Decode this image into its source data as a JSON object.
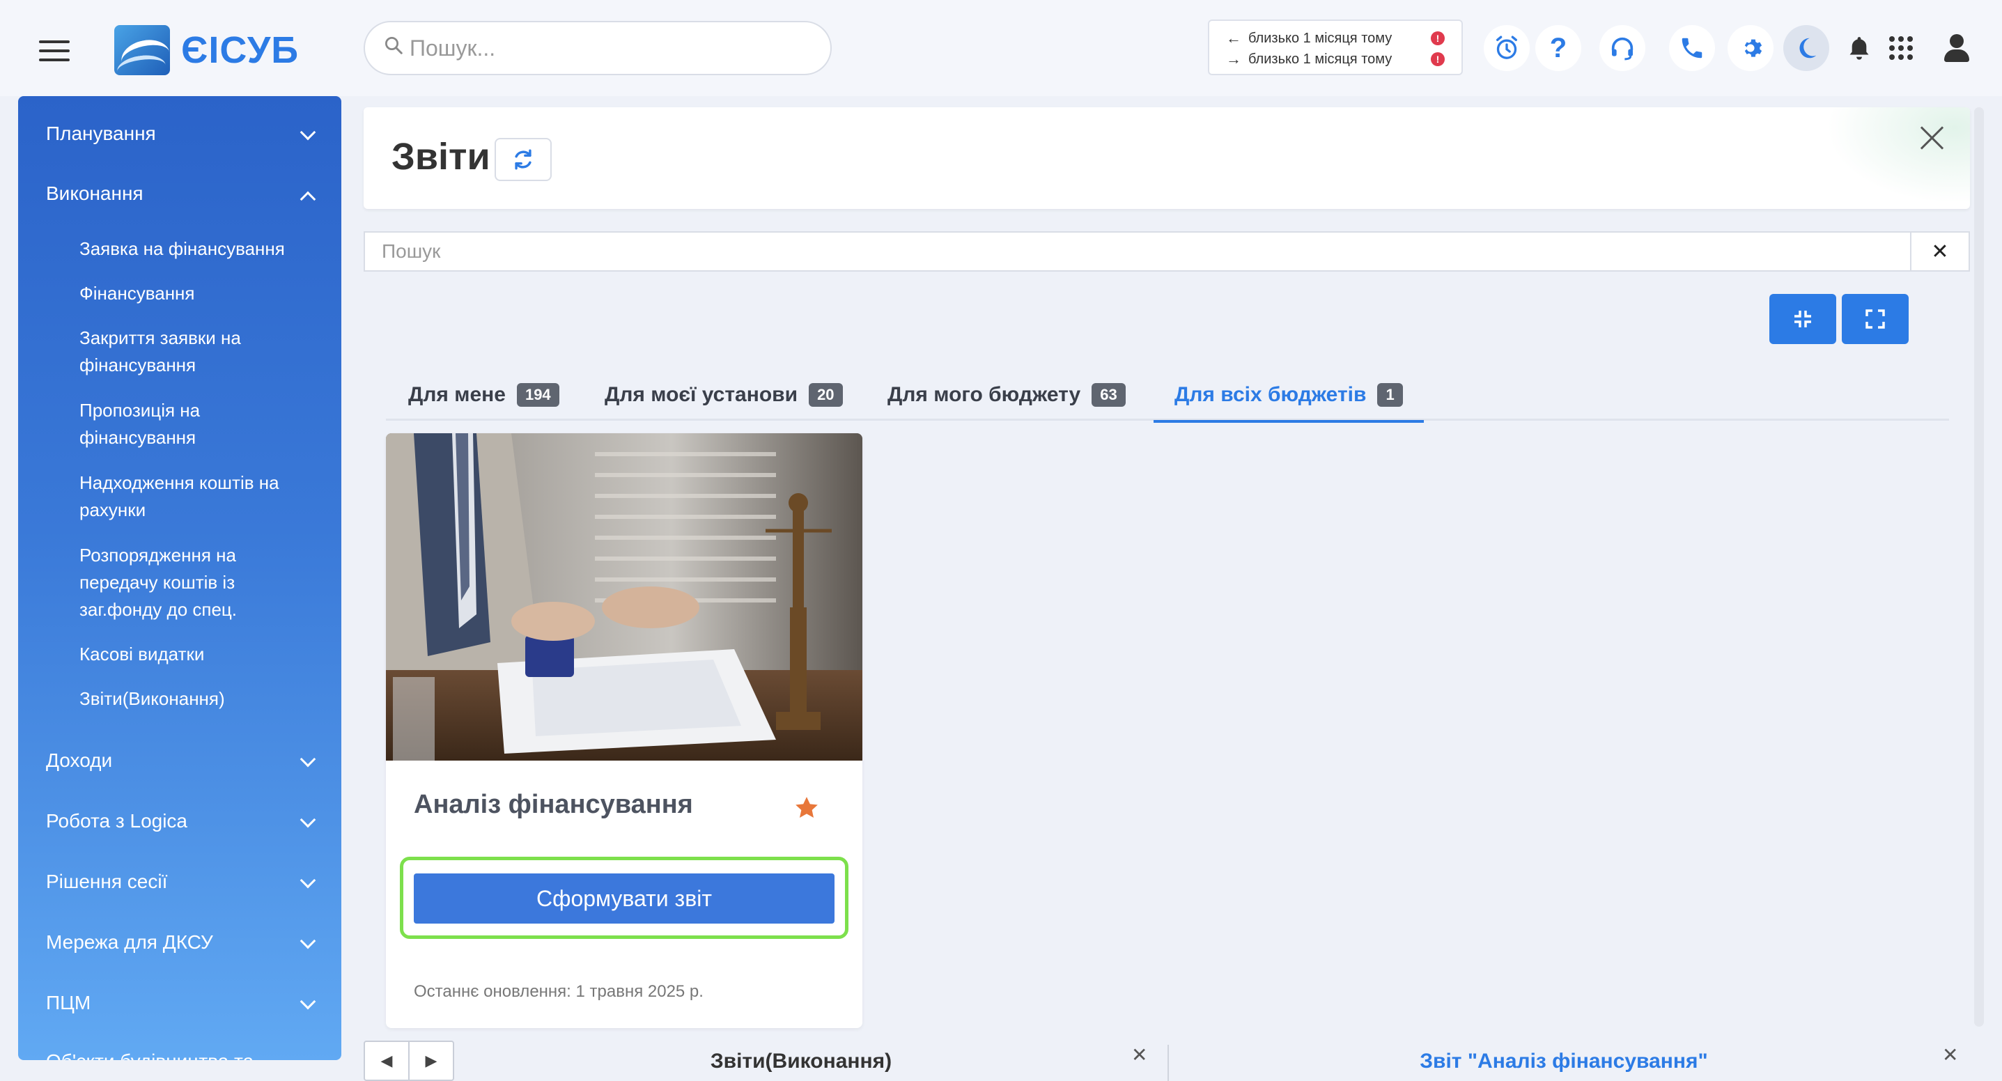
{
  "app": {
    "logo_text": "ЄІСУБ",
    "search_placeholder": "Пошук...",
    "sync": [
      {
        "direction": "←",
        "text": "близько 1 місяця тому",
        "alert": "!"
      },
      {
        "direction": "→",
        "text": "близько 1 місяця тому",
        "alert": "!"
      }
    ],
    "toolbar_icons": [
      "alarm-clock-icon",
      "help-icon",
      "headset-icon",
      "phone-icon",
      "gear-icon",
      "moon-icon",
      "bell-icon",
      "apps-grid-icon",
      "user-icon"
    ],
    "toolbar_glyphs": {
      "help": "?"
    }
  },
  "sidebar": {
    "groups": [
      {
        "label": "Планування",
        "expanded": false
      },
      {
        "label": "Виконання",
        "expanded": true
      },
      {
        "label": "Доходи",
        "expanded": false
      },
      {
        "label": "Робота з Logica",
        "expanded": false
      },
      {
        "label": "Рішення сесії",
        "expanded": false
      },
      {
        "label": "Мережа для ДКСУ",
        "expanded": false
      },
      {
        "label": "ПЦМ",
        "expanded": false
      },
      {
        "label": "Об'єкти будівництва та",
        "expanded": false
      }
    ],
    "items": [
      "Заявка на фінансування",
      "Фінансування",
      "Закриття заявки на фінансування",
      "Пропозиція на фінансування",
      "Надходження коштів на рахунки",
      "Розпорядження на передачу коштів із заг.фонду до спец.",
      "Касові видатки",
      "Звіти(Виконання)"
    ]
  },
  "main": {
    "title": "Звіти",
    "filter_placeholder": "Пошук",
    "filter_clear": "✕",
    "tabs": [
      {
        "label": "Для мене",
        "count": "194",
        "active": false
      },
      {
        "label": "Для моєї установи",
        "count": "20",
        "active": false
      },
      {
        "label": "Для мого бюджету",
        "count": "63",
        "active": false
      },
      {
        "label": "Для всіх бюджетів",
        "count": "1",
        "active": true
      }
    ],
    "card": {
      "title": "Аналіз фінансування",
      "button_label": "Сформувати звіт",
      "updated": "Останнє оновлення: 1 травня 2025 р.",
      "favorite": true
    }
  },
  "taskbar": {
    "prev": "◀",
    "next": "▶",
    "tabs": [
      {
        "label": "Звіти(Виконання)",
        "active": false
      },
      {
        "label": "Звіт \"Аналіз фінансування\"",
        "active": true
      }
    ],
    "close": "✕"
  },
  "colors": {
    "accent": "#2c7be5",
    "highlight": "#7de04c",
    "star": "#e8773a",
    "alert": "#e03a4d"
  }
}
